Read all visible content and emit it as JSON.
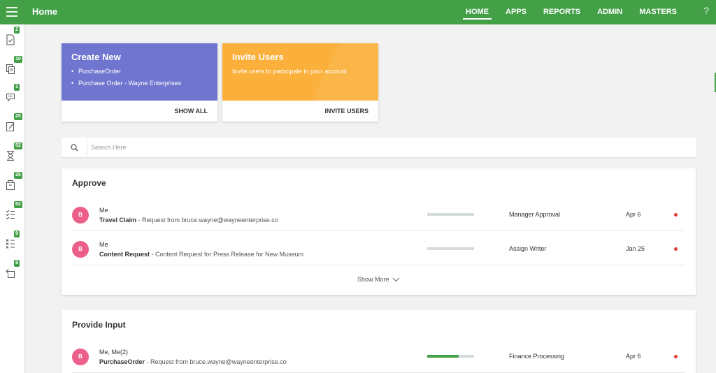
{
  "header": {
    "title": "Home",
    "nav": [
      "HOME",
      "APPS",
      "REPORTS",
      "ADMIN",
      "MASTERS"
    ],
    "active_nav": "HOME",
    "help": "?",
    "bar_color": "#43a047"
  },
  "sidebar": {
    "items": [
      {
        "badge": "2",
        "icon": "check-document-icon"
      },
      {
        "badge": "10",
        "icon": "documents-icon"
      },
      {
        "badge": "1",
        "icon": "comment-icon"
      },
      {
        "badge": "25",
        "icon": "edit-icon"
      },
      {
        "badge": "52",
        "icon": "hourglass-icon"
      },
      {
        "badge": "25",
        "icon": "archive-icon"
      },
      {
        "badge": "62",
        "icon": "checklist-icon"
      },
      {
        "badge": "9",
        "icon": "x-list-icon"
      },
      {
        "badge": "8",
        "icon": "return-icon"
      }
    ]
  },
  "tiles": {
    "create": {
      "title": "Create New",
      "items": [
        "PurchaseOrder",
        "Purchase Order - Wayne Enterprises"
      ],
      "action": "SHOW ALL"
    },
    "invite": {
      "title": "Invite Users",
      "description": "Invite users to participate in your account",
      "action": "INVITE USERS"
    }
  },
  "search": {
    "placeholder": "Search Here",
    "value": ""
  },
  "approve": {
    "title": "Approve",
    "rows": [
      {
        "avatar": "B",
        "who": "Me",
        "name": "Travel Claim",
        "detail": " - Request from bruce.wayne@wayneenterprise.co",
        "progress": 0,
        "stage": "Manager Approval",
        "date": "Apr 6"
      },
      {
        "avatar": "B",
        "who": "Me",
        "name": "Content Request",
        "detail": " - Content Request for Press Release for New Museum",
        "progress": 0,
        "stage": "Assign Writer",
        "date": "Jan 25"
      }
    ],
    "show_more": "Show More"
  },
  "provide_input": {
    "title": "Provide Input",
    "rows": [
      {
        "avatar": "B",
        "who": "Me, Me(2)",
        "name": "PurchaseOrder",
        "detail": " - Request from bruce.wayne@wayneenterprise.co",
        "progress": 0.67,
        "stage": "Finance Processing",
        "date": "Apr 6"
      }
    ]
  }
}
